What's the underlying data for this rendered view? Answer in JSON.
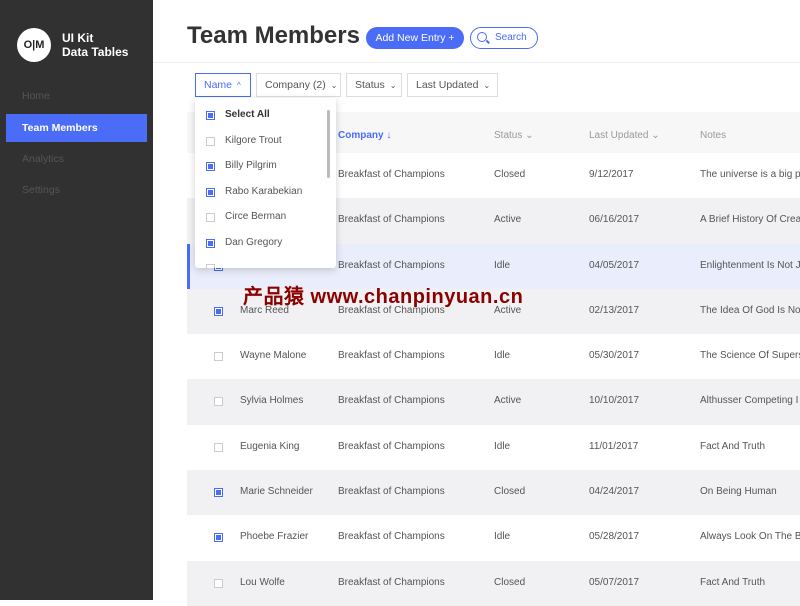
{
  "sidebar": {
    "logo": "O|M",
    "brand_line1": "UI Kit",
    "brand_line2": "Data Tables",
    "items": [
      {
        "label": "Home"
      },
      {
        "label": "Team Members",
        "active": true
      },
      {
        "label": "Analytics"
      },
      {
        "label": "Settings"
      }
    ]
  },
  "header": {
    "title": "Team Members",
    "add_label": "Add New Entry +",
    "search_placeholder": "Search"
  },
  "filters": [
    {
      "label": "Name",
      "open": true
    },
    {
      "label": "Company (2)"
    },
    {
      "label": "Status"
    },
    {
      "label": "Last Updated"
    }
  ],
  "dropdown": {
    "items": [
      {
        "label": "Select All",
        "checked": true
      },
      {
        "label": "Kilgore Trout",
        "checked": false
      },
      {
        "label": "Billy Pilgrim",
        "checked": true
      },
      {
        "label": "Rabo Karabekian",
        "checked": true
      },
      {
        "label": "Circe Berman",
        "checked": false
      },
      {
        "label": "Dan Gregory",
        "checked": true
      }
    ]
  },
  "table": {
    "columns": {
      "company": "Company ↓",
      "status": "Status ⌄",
      "updated": "Last Updated ⌄",
      "notes": "Notes"
    },
    "rows": [
      {
        "name": "",
        "company": "Breakfast of Champions",
        "status": "Closed",
        "updated": "9/12/2017",
        "notes": "The universe is a big p",
        "checked": false
      },
      {
        "name": "",
        "company": "Breakfast of Champions",
        "status": "Active",
        "updated": "06/16/2017",
        "notes": "A Brief History Of Crea",
        "checked": false
      },
      {
        "name": "",
        "company": "Breakfast of Champions",
        "status": "Idle",
        "updated": "04/05/2017",
        "notes": "Enlightenment Is Not J",
        "checked": true
      },
      {
        "name": "Marc Reed",
        "company": "Breakfast of Champions",
        "status": "Active",
        "updated": "02/13/2017",
        "notes": "The Idea Of God Is No",
        "checked": true
      },
      {
        "name": "Wayne Malone",
        "company": "Breakfast of Champions",
        "status": "Idle",
        "updated": "05/30/2017",
        "notes": "The Science Of Supers",
        "checked": false
      },
      {
        "name": "Sylvia Holmes",
        "company": "Breakfast of Champions",
        "status": "Active",
        "updated": "10/10/2017",
        "notes": "Althusser Competing I",
        "checked": false
      },
      {
        "name": "Eugenia King",
        "company": "Breakfast of Champions",
        "status": "Idle",
        "updated": "11/01/2017",
        "notes": "Fact And Truth",
        "checked": false
      },
      {
        "name": "Marie Schneider",
        "company": "Breakfast of Champions",
        "status": "Closed",
        "updated": "04/24/2017",
        "notes": "On Being Human",
        "checked": true
      },
      {
        "name": "Phoebe Frazier",
        "company": "Breakfast of Champions",
        "status": "Idle",
        "updated": "05/28/2017",
        "notes": "Always Look On The B",
        "checked": true
      },
      {
        "name": "Lou Wolfe",
        "company": "Breakfast of Champions",
        "status": "Closed",
        "updated": "05/07/2017",
        "notes": "Fact And Truth",
        "checked": false
      }
    ]
  },
  "watermark": "产品猿 www.chanpinyuan.cn",
  "colors": {
    "accent": "#4a6cf7",
    "sidebar": "#313131"
  }
}
